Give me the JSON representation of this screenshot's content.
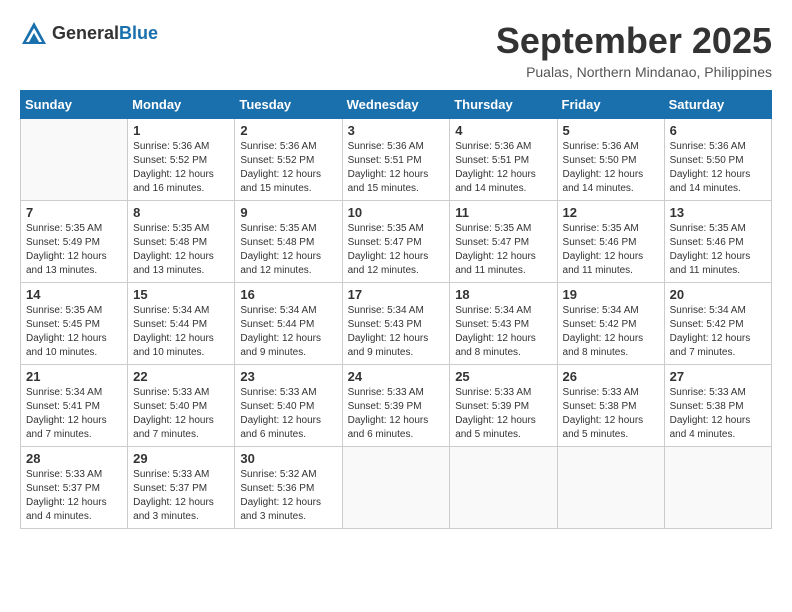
{
  "logo": {
    "general": "General",
    "blue": "Blue"
  },
  "title": "September 2025",
  "location": "Pualas, Northern Mindanao, Philippines",
  "days_of_week": [
    "Sunday",
    "Monday",
    "Tuesday",
    "Wednesday",
    "Thursday",
    "Friday",
    "Saturday"
  ],
  "weeks": [
    [
      {
        "day": "",
        "info": ""
      },
      {
        "day": "1",
        "info": "Sunrise: 5:36 AM\nSunset: 5:52 PM\nDaylight: 12 hours\nand 16 minutes."
      },
      {
        "day": "2",
        "info": "Sunrise: 5:36 AM\nSunset: 5:52 PM\nDaylight: 12 hours\nand 15 minutes."
      },
      {
        "day": "3",
        "info": "Sunrise: 5:36 AM\nSunset: 5:51 PM\nDaylight: 12 hours\nand 15 minutes."
      },
      {
        "day": "4",
        "info": "Sunrise: 5:36 AM\nSunset: 5:51 PM\nDaylight: 12 hours\nand 14 minutes."
      },
      {
        "day": "5",
        "info": "Sunrise: 5:36 AM\nSunset: 5:50 PM\nDaylight: 12 hours\nand 14 minutes."
      },
      {
        "day": "6",
        "info": "Sunrise: 5:36 AM\nSunset: 5:50 PM\nDaylight: 12 hours\nand 14 minutes."
      }
    ],
    [
      {
        "day": "7",
        "info": "Sunrise: 5:35 AM\nSunset: 5:49 PM\nDaylight: 12 hours\nand 13 minutes."
      },
      {
        "day": "8",
        "info": "Sunrise: 5:35 AM\nSunset: 5:48 PM\nDaylight: 12 hours\nand 13 minutes."
      },
      {
        "day": "9",
        "info": "Sunrise: 5:35 AM\nSunset: 5:48 PM\nDaylight: 12 hours\nand 12 minutes."
      },
      {
        "day": "10",
        "info": "Sunrise: 5:35 AM\nSunset: 5:47 PM\nDaylight: 12 hours\nand 12 minutes."
      },
      {
        "day": "11",
        "info": "Sunrise: 5:35 AM\nSunset: 5:47 PM\nDaylight: 12 hours\nand 11 minutes."
      },
      {
        "day": "12",
        "info": "Sunrise: 5:35 AM\nSunset: 5:46 PM\nDaylight: 12 hours\nand 11 minutes."
      },
      {
        "day": "13",
        "info": "Sunrise: 5:35 AM\nSunset: 5:46 PM\nDaylight: 12 hours\nand 11 minutes."
      }
    ],
    [
      {
        "day": "14",
        "info": "Sunrise: 5:35 AM\nSunset: 5:45 PM\nDaylight: 12 hours\nand 10 minutes."
      },
      {
        "day": "15",
        "info": "Sunrise: 5:34 AM\nSunset: 5:44 PM\nDaylight: 12 hours\nand 10 minutes."
      },
      {
        "day": "16",
        "info": "Sunrise: 5:34 AM\nSunset: 5:44 PM\nDaylight: 12 hours\nand 9 minutes."
      },
      {
        "day": "17",
        "info": "Sunrise: 5:34 AM\nSunset: 5:43 PM\nDaylight: 12 hours\nand 9 minutes."
      },
      {
        "day": "18",
        "info": "Sunrise: 5:34 AM\nSunset: 5:43 PM\nDaylight: 12 hours\nand 8 minutes."
      },
      {
        "day": "19",
        "info": "Sunrise: 5:34 AM\nSunset: 5:42 PM\nDaylight: 12 hours\nand 8 minutes."
      },
      {
        "day": "20",
        "info": "Sunrise: 5:34 AM\nSunset: 5:42 PM\nDaylight: 12 hours\nand 7 minutes."
      }
    ],
    [
      {
        "day": "21",
        "info": "Sunrise: 5:34 AM\nSunset: 5:41 PM\nDaylight: 12 hours\nand 7 minutes."
      },
      {
        "day": "22",
        "info": "Sunrise: 5:33 AM\nSunset: 5:40 PM\nDaylight: 12 hours\nand 7 minutes."
      },
      {
        "day": "23",
        "info": "Sunrise: 5:33 AM\nSunset: 5:40 PM\nDaylight: 12 hours\nand 6 minutes."
      },
      {
        "day": "24",
        "info": "Sunrise: 5:33 AM\nSunset: 5:39 PM\nDaylight: 12 hours\nand 6 minutes."
      },
      {
        "day": "25",
        "info": "Sunrise: 5:33 AM\nSunset: 5:39 PM\nDaylight: 12 hours\nand 5 minutes."
      },
      {
        "day": "26",
        "info": "Sunrise: 5:33 AM\nSunset: 5:38 PM\nDaylight: 12 hours\nand 5 minutes."
      },
      {
        "day": "27",
        "info": "Sunrise: 5:33 AM\nSunset: 5:38 PM\nDaylight: 12 hours\nand 4 minutes."
      }
    ],
    [
      {
        "day": "28",
        "info": "Sunrise: 5:33 AM\nSunset: 5:37 PM\nDaylight: 12 hours\nand 4 minutes."
      },
      {
        "day": "29",
        "info": "Sunrise: 5:33 AM\nSunset: 5:37 PM\nDaylight: 12 hours\nand 3 minutes."
      },
      {
        "day": "30",
        "info": "Sunrise: 5:32 AM\nSunset: 5:36 PM\nDaylight: 12 hours\nand 3 minutes."
      },
      {
        "day": "",
        "info": ""
      },
      {
        "day": "",
        "info": ""
      },
      {
        "day": "",
        "info": ""
      },
      {
        "day": "",
        "info": ""
      }
    ]
  ]
}
